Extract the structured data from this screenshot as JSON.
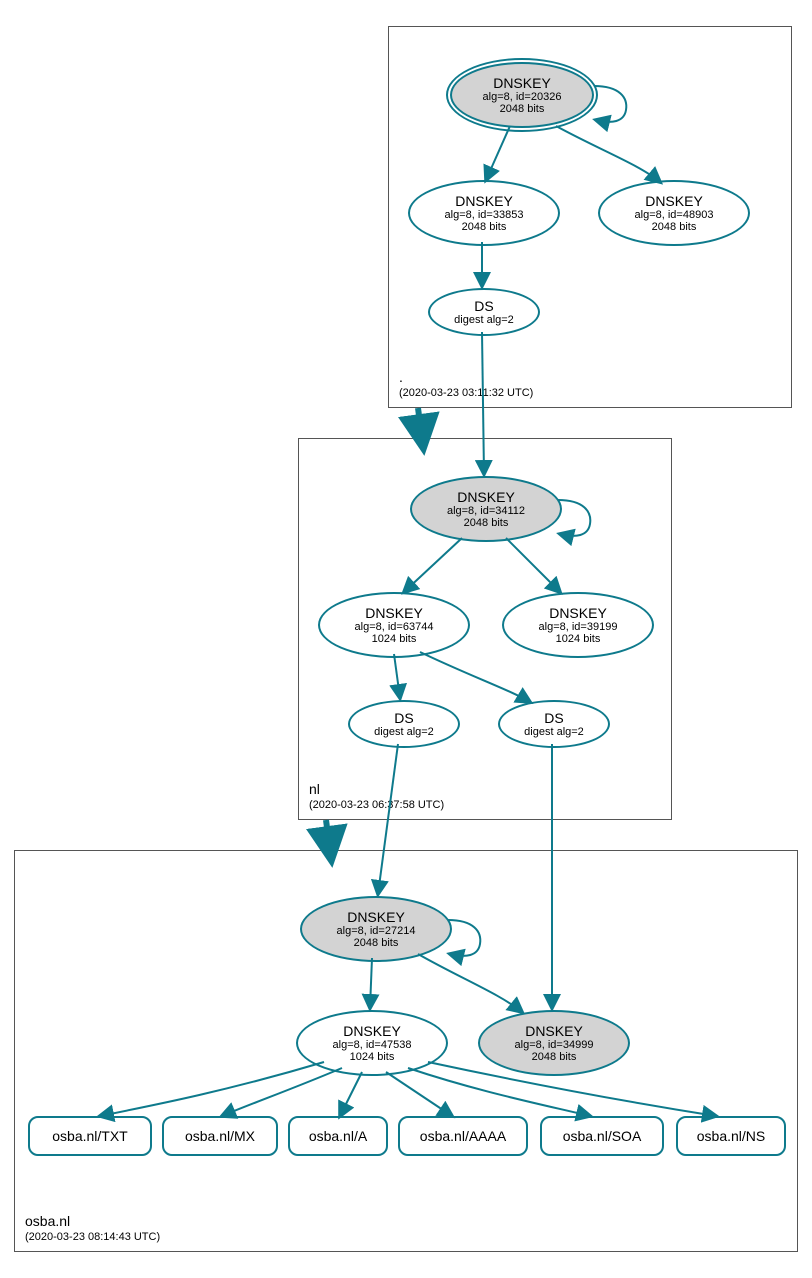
{
  "zones": {
    "root": {
      "name": ".",
      "timestamp": "(2020-03-23 03:11:32 UTC)"
    },
    "nl": {
      "name": "nl",
      "timestamp": "(2020-03-23 06:37:58 UTC)"
    },
    "osba": {
      "name": "osba.nl",
      "timestamp": "(2020-03-23 08:14:43 UTC)"
    }
  },
  "nodes": {
    "root_ksk": {
      "title": "DNSKEY",
      "sub1": "alg=8, id=20326",
      "sub2": "2048 bits"
    },
    "root_zsk1": {
      "title": "DNSKEY",
      "sub1": "alg=8, id=33853",
      "sub2": "2048 bits"
    },
    "root_zsk2": {
      "title": "DNSKEY",
      "sub1": "alg=8, id=48903",
      "sub2": "2048 bits"
    },
    "root_ds": {
      "title": "DS",
      "sub1": "digest alg=2"
    },
    "nl_ksk": {
      "title": "DNSKEY",
      "sub1": "alg=8, id=34112",
      "sub2": "2048 bits"
    },
    "nl_zsk1": {
      "title": "DNSKEY",
      "sub1": "alg=8, id=63744",
      "sub2": "1024 bits"
    },
    "nl_zsk2": {
      "title": "DNSKEY",
      "sub1": "alg=8, id=39199",
      "sub2": "1024 bits"
    },
    "nl_ds1": {
      "title": "DS",
      "sub1": "digest alg=2"
    },
    "nl_ds2": {
      "title": "DS",
      "sub1": "digest alg=2"
    },
    "osba_ksk": {
      "title": "DNSKEY",
      "sub1": "alg=8, id=27214",
      "sub2": "2048 bits"
    },
    "osba_zsk": {
      "title": "DNSKEY",
      "sub1": "alg=8, id=47538",
      "sub2": "1024 bits"
    },
    "osba_ksk2": {
      "title": "DNSKEY",
      "sub1": "alg=8, id=34999",
      "sub2": "2048 bits"
    },
    "rr_txt": {
      "label": "osba.nl/TXT"
    },
    "rr_mx": {
      "label": "osba.nl/MX"
    },
    "rr_a": {
      "label": "osba.nl/A"
    },
    "rr_aaaa": {
      "label": "osba.nl/AAAA"
    },
    "rr_soa": {
      "label": "osba.nl/SOA"
    },
    "rr_ns": {
      "label": "osba.nl/NS"
    }
  },
  "colors": {
    "stroke": "#0e7a8c"
  }
}
